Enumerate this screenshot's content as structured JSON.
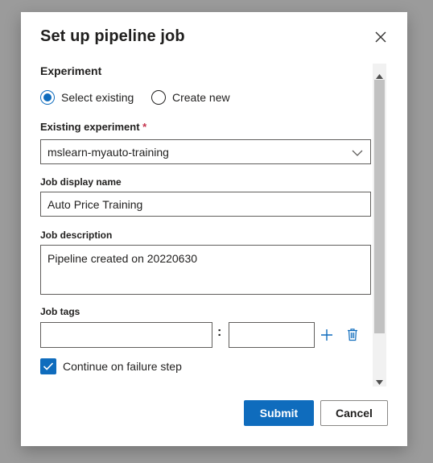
{
  "dialog": {
    "title": "Set up pipeline job",
    "close_icon": "close-icon"
  },
  "experiment": {
    "section_title": "Experiment",
    "options": [
      {
        "label": "Select existing",
        "selected": true
      },
      {
        "label": "Create new",
        "selected": false
      }
    ],
    "existing_label": "Existing experiment",
    "required_marker": "*",
    "existing_value": "mslearn-myauto-training"
  },
  "job": {
    "display_name_label": "Job display name",
    "display_name_value": "Auto Price Training",
    "description_label": "Job description",
    "description_value": "Pipeline created on 20220630",
    "tags_label": "Job tags",
    "tag_separator": ":",
    "tag_key_value": "",
    "tag_value_value": ""
  },
  "options": {
    "continue_on_failure_label": "Continue on failure step",
    "continue_on_failure_checked": true
  },
  "footer": {
    "submit_label": "Submit",
    "cancel_label": "Cancel"
  },
  "colors": {
    "accent": "#0f6cbd",
    "required": "#c4314b",
    "overlay": "#9b9b9b"
  }
}
